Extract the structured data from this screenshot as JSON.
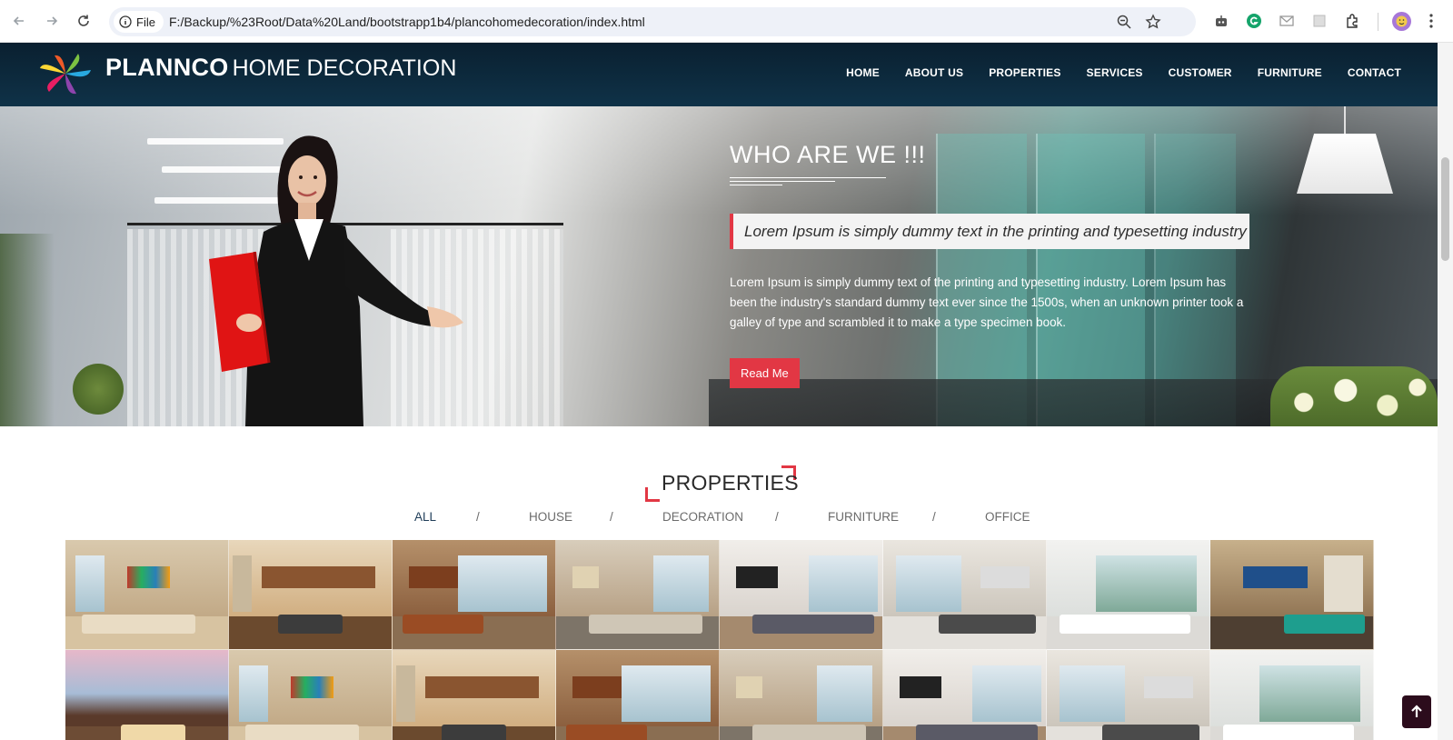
{
  "browser": {
    "chip_label": "File",
    "url": "F:/Backup/%23Root/Data%20Land/bootstrapp1b4/plancohomedecoration/index.html",
    "icons": [
      "back-icon",
      "forward-icon",
      "reload-icon",
      "info-icon",
      "zoom-icon",
      "star-icon",
      "robot-icon",
      "grammarly-icon",
      "mail-icon",
      "screenshot-icon",
      "extensions-icon",
      "profile-avatar",
      "menu-icon"
    ]
  },
  "site": {
    "brand_bold": "PLANNCO",
    "brand_light": "HOME DECORATION",
    "menu": [
      "HOME",
      "ABOUT US",
      "PROPERTIES",
      "SERVICES",
      "CUSTOMER",
      "FURNITURE",
      "CONTACT"
    ]
  },
  "hero": {
    "title": "WHO ARE WE !!!",
    "quote": "Lorem Ipsum is simply dummy text in the printing and typesetting industry",
    "paragraph": "Lorem Ipsum is simply dummy text of the printing and typesetting industry. Lorem Ipsum has been the industry's standard dummy text ever since the 1500s, when an unknown printer took a galley of type and scrambled it to make a type specimen book.",
    "button": "Read Me"
  },
  "properties": {
    "title": "PROPERTIES",
    "filters": [
      "ALL",
      "HOUSE",
      "DECORATION",
      "FURNITURE",
      "OFFICE"
    ],
    "separator": "/",
    "active_filter": "ALL"
  },
  "colors": {
    "accent": "#e23744",
    "header": "#0f3248",
    "active_filter": "#1f3d58"
  }
}
